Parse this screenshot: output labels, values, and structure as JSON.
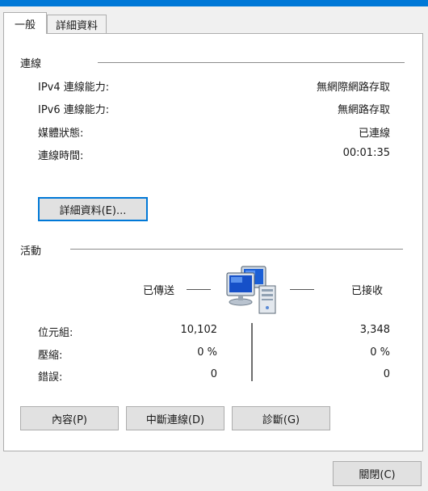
{
  "tabs": [
    {
      "label": "一般"
    },
    {
      "label": "詳細資料"
    }
  ],
  "connection": {
    "title": "連線",
    "rows": [
      {
        "label": "IPv4 連線能力:",
        "value": "無網際網路存取"
      },
      {
        "label": "IPv6 連線能力:",
        "value": "無網路存取"
      },
      {
        "label": "媒體狀態:",
        "value": "已連線"
      },
      {
        "label": "連線時間:",
        "value": "00:01:35"
      }
    ],
    "details_button": "詳細資料(E)..."
  },
  "activity": {
    "title": "活動",
    "sent_label": "已傳送",
    "received_label": "已接收",
    "rows": [
      {
        "label": "位元組:",
        "sent": "10,102",
        "received": "3,348"
      },
      {
        "label": "壓縮:",
        "sent": "0 %",
        "received": "0 %"
      },
      {
        "label": "錯誤:",
        "sent": "0",
        "received": "0"
      }
    ]
  },
  "buttons": {
    "properties": "內容(P)",
    "disable": "中斷連線(D)",
    "diagnose": "診斷(G)",
    "close": "關閉(C)"
  },
  "icons": {
    "network": "network-computers-icon"
  },
  "colors": {
    "accent": "#0078d7"
  }
}
